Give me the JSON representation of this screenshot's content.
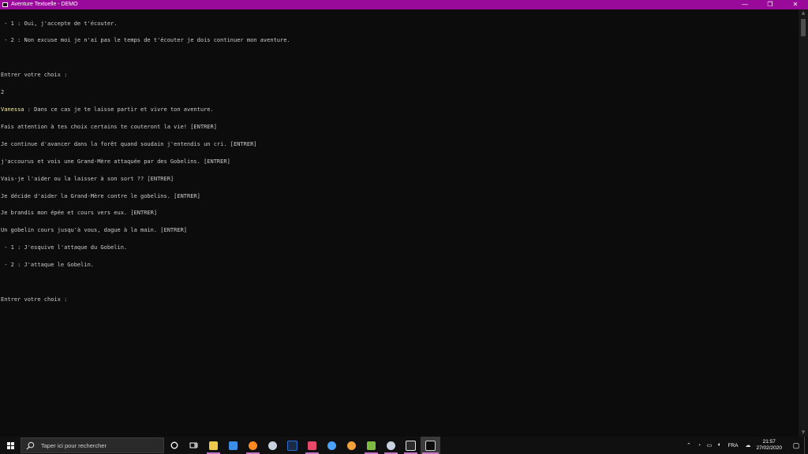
{
  "window": {
    "title": "Aventure Textuelle - DEMO",
    "controls": {
      "minimize": "—",
      "maximize": "❐",
      "close": "✕"
    },
    "accent_color": "#9a0a9a"
  },
  "console": {
    "text_color": "#cccccc",
    "speaker_color": "#f9f1a5",
    "lines": [
      " - 1 : Oui, j'accepte de t'écouter.",
      " - 2 : Non excuse moi je n'ai pas le temps de t'écouter je dois continuer mon aventure.",
      "",
      "Entrer votre choix :",
      "2",
      "",
      "Fais attention à tes choix certains te couteront la vie! [ENTRER]",
      "Je continue d'avancer dans la forêt quand soudain j'entendis un cri. [ENTRER]",
      "j'accourus et vois une Grand-Mère attaquée par des Gobelins. [ENTRER]",
      "Vais-je l'aider ou la laisser à son sort ?? [ENTRER]",
      "Je décide d'aider la Grand-Mère contre le gobelins. [ENTRER]",
      "Je brandis mon épée et cours vers eux. [ENTRER]",
      "Un gobelin cours jusqu'à vous, dague à la main. [ENTRER]",
      " - 1 : J'esquive l'attaque du Gobelin.",
      " - 2 : J'attaque le Gobelin.",
      "",
      "Entrer votre choix :"
    ],
    "dialogue": {
      "speaker": "Vanessa",
      "text": " : Dans ce cas je te laisse partir et vivre ton aventure."
    }
  },
  "taskbar": {
    "search_placeholder": "Taper ici pour rechercher",
    "apps": [
      {
        "name": "file-explorer",
        "color": "#f2c84b"
      },
      {
        "name": "mail",
        "color": "#3a8ee6"
      },
      {
        "name": "firefox",
        "color": "#ff8a1f"
      },
      {
        "name": "steam",
        "color": "#c9d3e0"
      },
      {
        "name": "app-dark",
        "color": "#2a6bd6"
      },
      {
        "name": "app-red",
        "color": "#e8496a"
      },
      {
        "name": "app-blue-circle",
        "color": "#4aa3ff"
      },
      {
        "name": "app-orange-circle",
        "color": "#f2a23a"
      },
      {
        "name": "app-green",
        "color": "#7dbb42"
      },
      {
        "name": "steam-2",
        "color": "#c9d3e0"
      },
      {
        "name": "epic-games",
        "color": "#e6e6e6"
      },
      {
        "name": "terminal",
        "color": "#d0d0d0"
      }
    ],
    "tray": {
      "language": "FRA",
      "time": "21:57",
      "date": "27/02/2020"
    }
  }
}
